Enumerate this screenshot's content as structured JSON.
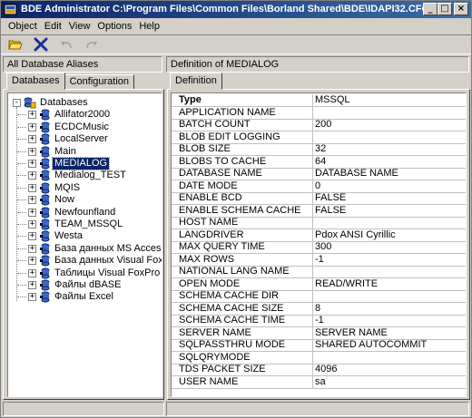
{
  "window": {
    "title": "BDE Administrator  C:\\Program Files\\Common Files\\Borland Shared\\BDE\\IDAPI32.CFG",
    "minimize": "_",
    "maximize": "□",
    "close": "×"
  },
  "menu": {
    "items": [
      {
        "label": "Object",
        "key": "object"
      },
      {
        "label": "Edit",
        "key": "edit"
      },
      {
        "label": "View",
        "key": "view"
      },
      {
        "label": "Options",
        "key": "options"
      },
      {
        "label": "Help",
        "key": "help"
      }
    ]
  },
  "toolbar": {
    "icons": [
      "open-folder-icon",
      "delete-x-icon",
      "undo-icon",
      "redo-icon"
    ],
    "colors": {
      "folder": "#d8b000",
      "delete": "#1c2ca0",
      "disabled": "#a0a0a0"
    }
  },
  "left_panel": {
    "header": "All Database Aliases",
    "tabs": [
      "Databases",
      "Configuration"
    ],
    "active_tab": "Databases",
    "tree": {
      "root": "Databases",
      "items": [
        {
          "label": "Allifator2000",
          "expander": "+"
        },
        {
          "label": "ECDCMusic",
          "expander": "+"
        },
        {
          "label": "LocalServer",
          "expander": "+"
        },
        {
          "label": "Main",
          "expander": "+"
        },
        {
          "label": "MEDIALOG",
          "expander": "+",
          "selected": true
        },
        {
          "label": "Medialog_TEST",
          "expander": "+"
        },
        {
          "label": "MQIS",
          "expander": "+"
        },
        {
          "label": "Now",
          "expander": "+"
        },
        {
          "label": "Newfounfland",
          "expander": "+"
        },
        {
          "label": "TEAM_MSSQL",
          "expander": "+"
        },
        {
          "label": "Westa",
          "expander": "+"
        },
        {
          "label": "База данных MS Access",
          "expander": "+"
        },
        {
          "label": "База данных Visual FoxPro",
          "expander": "+"
        },
        {
          "label": "Таблицы Visual FoxPro",
          "expander": "+"
        },
        {
          "label": "Файлы dBASE",
          "expander": "+"
        },
        {
          "label": "Файлы Excel",
          "expander": "+"
        }
      ]
    }
  },
  "right_panel": {
    "header": "Definition of MEDIALOG",
    "tabs": [
      "Definition"
    ],
    "properties": [
      {
        "name": "Type",
        "value": "MSSQL"
      },
      {
        "name": "APPLICATION NAME",
        "value": ""
      },
      {
        "name": "BATCH COUNT",
        "value": "200"
      },
      {
        "name": "BLOB EDIT LOGGING",
        "value": ""
      },
      {
        "name": "BLOB SIZE",
        "value": "32"
      },
      {
        "name": "BLOBS TO CACHE",
        "value": "64"
      },
      {
        "name": "DATABASE NAME",
        "value": "DATABASE NAME"
      },
      {
        "name": "DATE MODE",
        "value": "0"
      },
      {
        "name": "ENABLE BCD",
        "value": "FALSE"
      },
      {
        "name": "ENABLE SCHEMA CACHE",
        "value": "FALSE"
      },
      {
        "name": "HOST NAME",
        "value": ""
      },
      {
        "name": "LANGDRIVER",
        "value": "Pdox ANSI Cyrillic"
      },
      {
        "name": "MAX QUERY TIME",
        "value": "300"
      },
      {
        "name": "MAX ROWS",
        "value": "-1"
      },
      {
        "name": "NATIONAL LANG NAME",
        "value": ""
      },
      {
        "name": "OPEN MODE",
        "value": "READ/WRITE"
      },
      {
        "name": "SCHEMA CACHE DIR",
        "value": ""
      },
      {
        "name": "SCHEMA CACHE SIZE",
        "value": "8"
      },
      {
        "name": "SCHEMA CACHE TIME",
        "value": "-1"
      },
      {
        "name": "SERVER NAME",
        "value": "SERVER NAME"
      },
      {
        "name": "SQLPASSTHRU MODE",
        "value": "SHARED AUTOCOMMIT"
      },
      {
        "name": "SQLQRYMODE",
        "value": ""
      },
      {
        "name": "TDS PACKET SIZE",
        "value": "4096"
      },
      {
        "name": "USER NAME",
        "value": "sa"
      }
    ]
  }
}
